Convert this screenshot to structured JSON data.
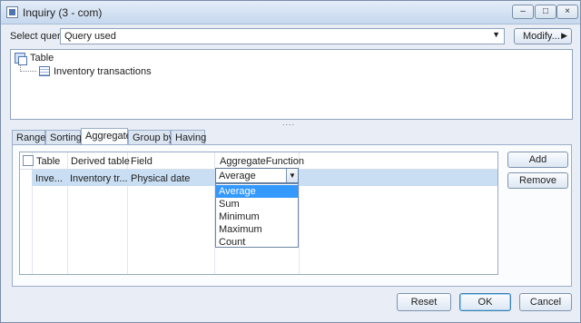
{
  "window": {
    "title": "Inquiry (3 - com)",
    "controls": {
      "minimize": "–",
      "maximize": "□",
      "close": "×"
    }
  },
  "select_query": {
    "label": "Select query:",
    "value": "Query used",
    "modify_label": "Modify..."
  },
  "tree": {
    "root": {
      "label": "Table",
      "icon": "table-group-icon"
    },
    "child": {
      "label": "Inventory transactions",
      "icon": "table-icon"
    }
  },
  "splitter_grip": "....",
  "tabs": [
    {
      "label": "Range"
    },
    {
      "label": "Sorting"
    },
    {
      "label": "Aggregate",
      "active": true
    },
    {
      "label": "Group by"
    },
    {
      "label": "Having"
    }
  ],
  "grid": {
    "headers": {
      "table": "Table",
      "derived_table": "Derived table",
      "field": "Field",
      "aggregate_function": "AggregateFunction"
    },
    "rows": [
      {
        "table": "Inve...",
        "derived_table": "Inventory tr...",
        "field": "Physical date",
        "aggregate_function": "Average"
      }
    ]
  },
  "dropdown": {
    "options": [
      "Average",
      "Sum",
      "Minimum",
      "Maximum",
      "Count"
    ],
    "selected": "Average"
  },
  "side_buttons": {
    "add": "Add",
    "remove": "Remove"
  },
  "footer_buttons": {
    "reset": "Reset",
    "ok": "OK",
    "cancel": "Cancel"
  },
  "colors": {
    "selection": "#3399ff",
    "row_highlight": "#c9def3",
    "titlebar": "#c6d8ee"
  }
}
